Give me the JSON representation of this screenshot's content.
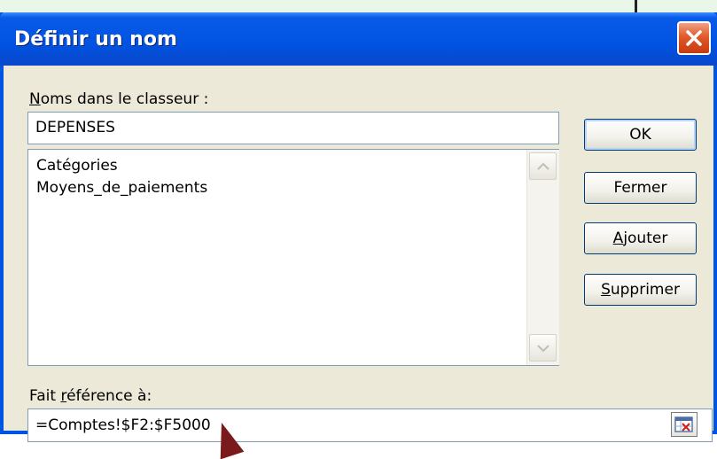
{
  "window": {
    "title": "Définir un nom"
  },
  "names_label": {
    "first_char": "N",
    "rest": "oms dans le classeur :"
  },
  "name_input": {
    "value": "DEPENSES"
  },
  "names_list": {
    "items": [
      "Catégories",
      "Moyens_de_paiements"
    ]
  },
  "buttons": {
    "ok": "OK",
    "close": "Fermer",
    "add_first": "A",
    "add_rest": "jouter",
    "delete_first": "S",
    "delete_rest": "upprimer"
  },
  "ref_label": {
    "before": "Fait ",
    "underlined": "r",
    "after": "éférence à:"
  },
  "ref_input": {
    "value": "=Comptes!$F2:$F5000"
  },
  "colors": {
    "titlebar": "#0053e1",
    "dialog_bg": "#ece9d8",
    "close_button": "#e05a2a"
  },
  "icons": {
    "close": "close-icon",
    "scroll_up": "chevron-up-icon",
    "scroll_down": "chevron-down-icon",
    "range_picker": "range-select-icon"
  }
}
